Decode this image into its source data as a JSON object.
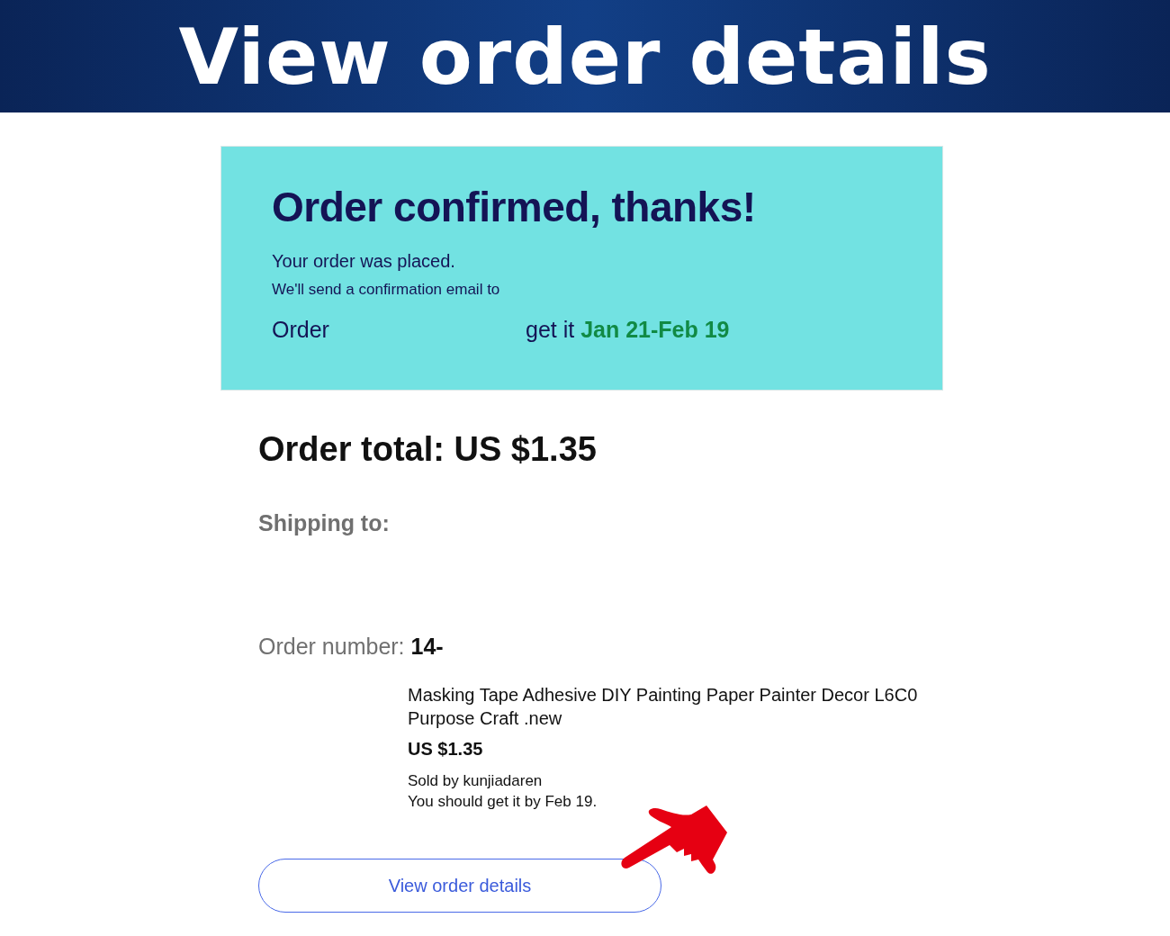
{
  "banner": {
    "title": "View order details"
  },
  "confirmation": {
    "heading": "Order confirmed, thanks!",
    "message": "Your order was placed.",
    "email_note": "We'll send a confirmation email to",
    "order_label": "Order",
    "delivery": "get it **Jan 21-Feb 19**"
  },
  "summary": {
    "total": "Order total: US $1.35",
    "shipping_label": "Shipping to:",
    "order_number": "Order number: **14-**"
  },
  "item": {
    "title": "Masking Tape Adhesive DIY Painting Paper Painter Decor L6C0 Purpose Craft .new",
    "price": "US $1.35",
    "seller": "Sold by kunjiadaren",
    "delivery": "You should get it by Feb 19."
  },
  "button": {
    "label": "View order details"
  }
}
